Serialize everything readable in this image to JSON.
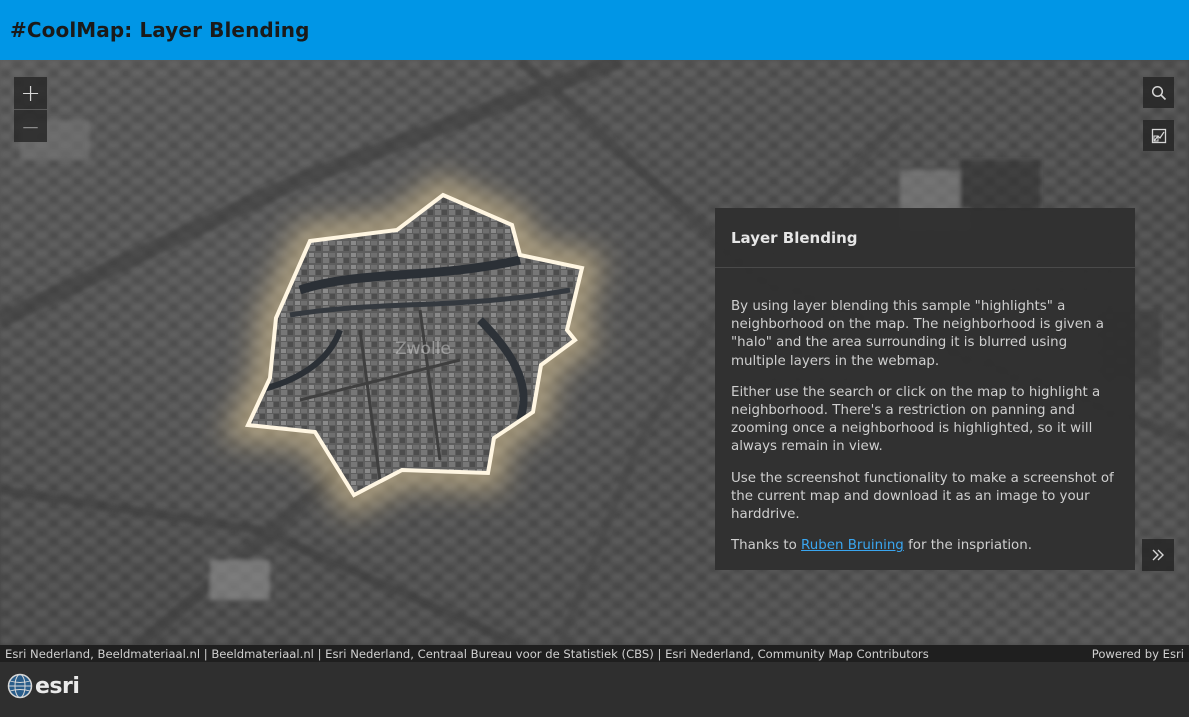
{
  "header": {
    "title": "#CoolMap: Layer Blending"
  },
  "map": {
    "zoom_in_label": "+",
    "zoom_out_label": "—",
    "place_label": "Zwolle",
    "halo_color": "#f3d9a0"
  },
  "tools": {
    "search_icon": "search-icon",
    "screenshot_icon": "screenshot-icon"
  },
  "panel": {
    "title": "Layer Blending",
    "paragraphs": [
      "By using layer blending this sample \"highlights\" a neighborhood on the map. The neighborhood is given a \"halo\" and the area surrounding it is blurred using multiple layers in the webmap.",
      "Either use the search or click on the map to highlight a neighborhood. There's a restriction on panning and zooming once a neighborhood is highlighted, so it will always remain in view.",
      "Use the screenshot functionality to make a screenshot of the current map and download it as an image to your harddrive."
    ],
    "thanks_prefix": "Thanks to ",
    "thanks_link": "Ruben Bruining",
    "thanks_suffix": " for the inspriation.",
    "collapse_icon": "double-chevron-right-icon"
  },
  "attribution": {
    "sources": "Esri Nederland, Beeldmateriaal.nl | Beeldmateriaal.nl | Esri Nederland, Centraal Bureau voor de Statistiek (CBS) | Esri Nederland, Community Map Contributors",
    "powered_by": "Powered by Esri"
  },
  "footer": {
    "logo_text": "esri"
  }
}
